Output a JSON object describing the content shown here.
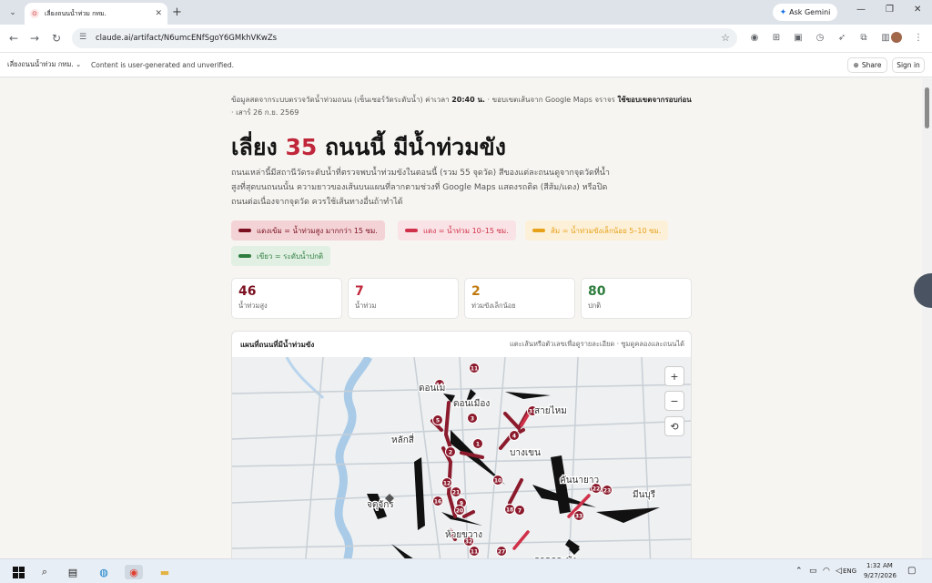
{
  "browser": {
    "tab_title": "เลี่ยงถนนน้ำท่วม กทม.",
    "ask_gemini": "Ask Gemini",
    "url": "claude.ai/artifact/N6umcENfSgoY6GMkhVKwZs"
  },
  "artifact_bar": {
    "name": "เลี่ยงถนนน้ำท่วม กทม.",
    "note": "Content is user-generated and unverified.",
    "share": "Share",
    "signin": "Sign in"
  },
  "article": {
    "meta_prefix": "ข้อมูลสดจากระบบตรวจวัดน้ำท่วมถนน (เซ็นเซอร์วัดระดับน้ำ) ค่าเวลา",
    "meta_time": "20:40 น.",
    "meta_mid": "· ขอบเขตเส้นจาก Google Maps จราจร",
    "meta_bold": "ใช้ขอบเขตจากรอบก่อน",
    "meta_date": "· เสาร์ 26 ก.ย. 2569",
    "headline_pre": "เลี่ยง",
    "headline_num": "35",
    "headline_post": "ถนนนี้ มีน้ำท่วมขัง",
    "desc": "ถนนเหล่านี้มีสถานีวัดระดับน้ำที่ตรวจพบน้ำท่วมขังในตอนนี้ (รวม 55 จุดวัด) สีของแต่ละถนนดูจากจุดวัดที่น้ำสูงที่สุดบนถนนนั้น ความยาวของเส้นบนแผนที่ลากตามช่วงที่ Google Maps แสดงรถติด (สีส้ม/แดง) หรือปิดถนนต่อเนื่องจากจุดวัด ควรใช้เส้นทางอื่นถ้าทำได้"
  },
  "legend": [
    {
      "label": "แดงเข้ม = น้ำท่วมสูง มากกว่า 15 ซม.",
      "color": "#7a1020",
      "bg": "#f4d3d6"
    },
    {
      "label": "แดง = น้ำท่วม 10–15 ซม.",
      "color": "#d0314a",
      "bg": "#fae3e6"
    },
    {
      "label": "ส้ม = น้ำท่วมขังเล็กน้อย 5–10 ซม.",
      "color": "#e7a21a",
      "bg": "#fdf0d8"
    },
    {
      "label": "เขียว = ระดับน้ำปกติ",
      "color": "#2e7d3e",
      "bg": "#e1f0e3"
    }
  ],
  "stats": [
    {
      "value": "46",
      "label": "น้ำท่วมสูง",
      "color": "#7a1020"
    },
    {
      "value": "7",
      "label": "น้ำท่วม",
      "color": "#c0273b"
    },
    {
      "value": "2",
      "label": "ท่วมขังเล็กน้อย",
      "color": "#c07a10"
    },
    {
      "value": "80",
      "label": "ปกติ",
      "color": "#2e7d3e"
    }
  ],
  "map": {
    "title": "แผนที่ถนนที่มีน้ำท่วมขัง",
    "hint": "แตะเส้นหรือตัวเลขเพื่อดูรายละเอียด · ซูมดูคลองและถนนได้",
    "zoom_in": "+",
    "zoom_out": "−",
    "reset": "⟲",
    "place_labels": [
      "ดอนเมือง",
      "สายไหม",
      "หลักสี่",
      "บางเขน",
      "คันนายาว",
      "มีนบุรี",
      "จตุจักร",
      "ห้วยขวาง",
      "ลาดกระบัง",
      "ดอนเม"
    ],
    "markers": [
      "11",
      "14",
      "3",
      "5",
      "2",
      "1",
      "4",
      "31",
      "12",
      "21",
      "16",
      "10",
      "18",
      "7",
      "9",
      "22",
      "23",
      "33",
      "32",
      "20",
      "27",
      "11"
    ]
  },
  "taskbar": {
    "time": "1:32 AM",
    "date": "9/27/2026",
    "lang": "ENG"
  }
}
